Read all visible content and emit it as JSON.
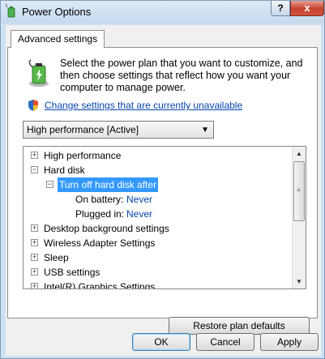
{
  "window": {
    "title": "Power Options",
    "help_label": "?",
    "close_label": "x"
  },
  "tabs": [
    {
      "label": "Advanced settings"
    }
  ],
  "intro_text": "Select the power plan that you want to customize, and then choose settings that reflect how you want your computer to manage power.",
  "change_link": "Change settings that are currently unavailable",
  "plan_select": {
    "value": "High performance [Active]"
  },
  "tree": {
    "items": [
      {
        "label": "High performance",
        "expander": "+"
      },
      {
        "label": "Hard disk",
        "expander": "−"
      },
      {
        "label": "Turn off hard disk after",
        "expander": "−",
        "selected": true
      },
      {
        "label": "On battery:",
        "value": "Never"
      },
      {
        "label": "Plugged in:",
        "value": "Never"
      },
      {
        "label": "Desktop background settings",
        "expander": "+"
      },
      {
        "label": "Wireless Adapter Settings",
        "expander": "+"
      },
      {
        "label": "Sleep",
        "expander": "+"
      },
      {
        "label": "USB settings",
        "expander": "+"
      },
      {
        "label": "Intel(R) Graphics Settings",
        "expander": "+"
      }
    ]
  },
  "buttons": {
    "restore": "Restore plan defaults",
    "ok": "OK",
    "cancel": "Cancel",
    "apply": "Apply"
  },
  "colors": {
    "selection": "#3399ff",
    "link": "#0645ad",
    "close_red": "#c5412c"
  }
}
